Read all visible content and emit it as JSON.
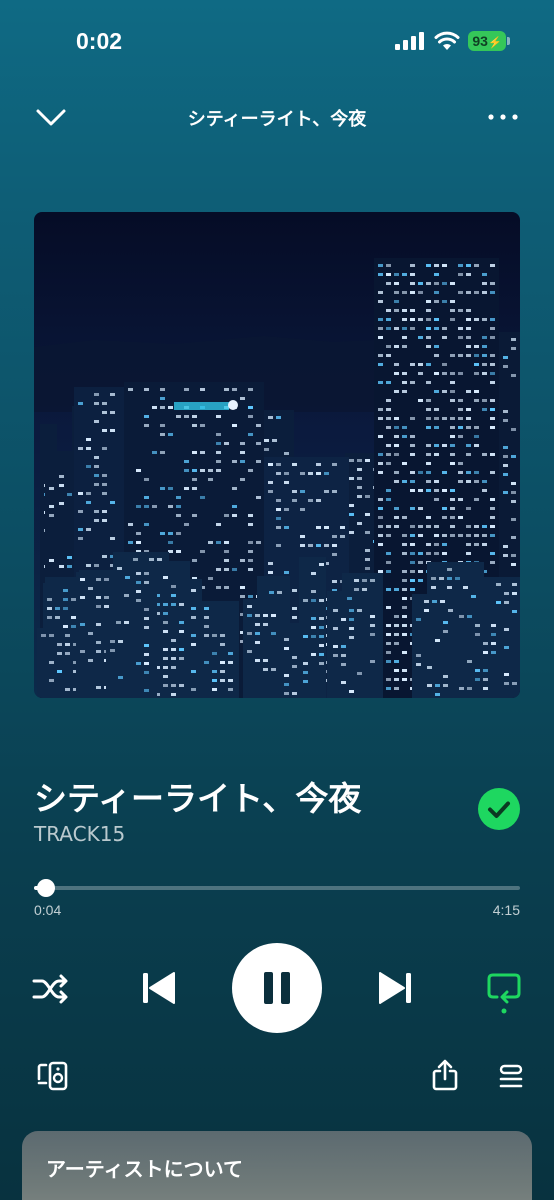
{
  "status_bar": {
    "time": "0:02",
    "battery": "93",
    "icons": [
      "cellular-signal-icon",
      "wifi-icon",
      "battery-charging-icon"
    ]
  },
  "header": {
    "title": "シティーライト、今夜",
    "icons": [
      "chevron-down-icon",
      "more-options-icon"
    ]
  },
  "album_art": {
    "image": "album-art-city-night"
  },
  "track": {
    "title": "シティーライト、今夜",
    "artist": "TRACK15",
    "liked": true
  },
  "playback": {
    "elapsed": "0:04",
    "duration": "4:15",
    "progress_fraction": 0.016,
    "state": "playing",
    "shuffle": false,
    "repeat": true
  },
  "controls": {
    "icons": [
      "shuffle-icon",
      "previous-icon",
      "pause-icon",
      "next-icon",
      "repeat-icon",
      "devices-icon",
      "share-icon",
      "queue-icon"
    ]
  },
  "artist_card": {
    "title": "アーティストについて"
  },
  "colors": {
    "accent_green": "#1ed760",
    "background_top": "#0f6a84",
    "background_bottom": "#08323f"
  }
}
